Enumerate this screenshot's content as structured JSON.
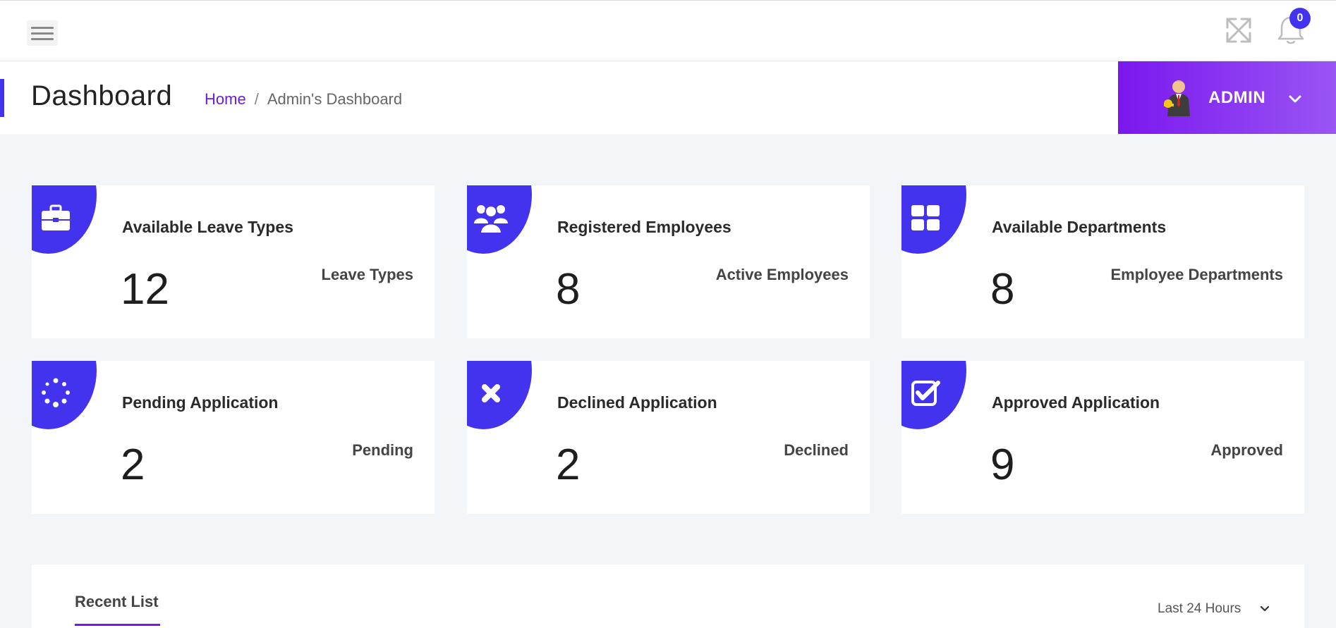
{
  "topbar": {
    "notification_count": "0"
  },
  "header": {
    "page_title": "Dashboard",
    "breadcrumb_home": "Home",
    "breadcrumb_separator": "/",
    "breadcrumb_current": "Admin's Dashboard",
    "user_name": "ADMIN"
  },
  "colors": {
    "accent": "#4433ee",
    "brand_purple": "#7a17ee",
    "background": "#f2f6f9"
  },
  "cards": [
    {
      "title": "Available Leave Types",
      "value": "12",
      "label": "Leave Types",
      "icon": "briefcase-icon"
    },
    {
      "title": "Registered Employees",
      "value": "8",
      "label": "Active Employees",
      "icon": "users-icon"
    },
    {
      "title": "Available Departments",
      "value": "8",
      "label": "Employee Departments",
      "icon": "grid-icon"
    },
    {
      "title": "Pending Application",
      "value": "2",
      "label": "Pending",
      "icon": "spinner-icon"
    },
    {
      "title": "Declined Application",
      "value": "2",
      "label": "Declined",
      "icon": "close-icon"
    },
    {
      "title": "Approved Application",
      "value": "9",
      "label": "Approved",
      "icon": "checkbox-icon"
    }
  ],
  "recent": {
    "title": "Recent List",
    "range_selected": "Last 24 Hours"
  }
}
